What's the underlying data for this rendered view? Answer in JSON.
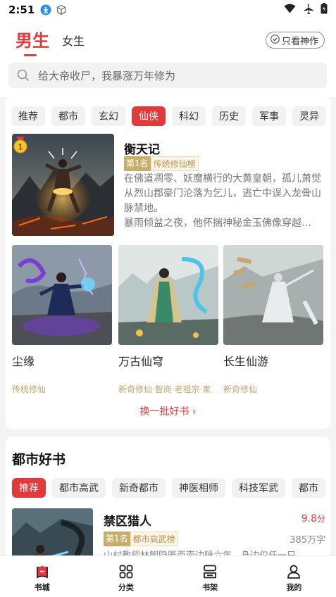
{
  "status_bar": {
    "time": "2:51"
  },
  "header": {
    "gender_active": "男生",
    "gender_other": "女生",
    "only_masterpiece": "只看神作",
    "search_placeholder": "给大帝收尸，我暴涨万年修为"
  },
  "category_tabs": [
    "推荐",
    "都市",
    "玄幻",
    "仙侠",
    "科幻",
    "历史",
    "军事",
    "灵异"
  ],
  "category_active": "仙侠",
  "featured_book": {
    "rank_badge": "1",
    "title": "衡天记",
    "rank_label": "第1名",
    "genre_label": "传统修仙榜",
    "description": "在佛道凋零、妖魔横行的大黄皇朝，孤儿萧觉从烈山郡豪门沦落为乞儿，逃亡中误入龙骨山脉禁地。",
    "description2": "暴雨倾盆之夜，他怀揣神秘金玉佛像穿越…"
  },
  "grid_books": [
    {
      "title": "尘缘",
      "tags": "传统修仙"
    },
    {
      "title": "万古仙穹",
      "tags": "新奇修仙·智商·老祖宗·家"
    },
    {
      "title": "长生仙游",
      "tags": "新奇修仙"
    }
  ],
  "refresh_label": "换一批好书",
  "section2": {
    "title": "都市好书",
    "tabs": [
      "推荐",
      "都市高武",
      "新奇都市",
      "神医相师",
      "科技军武",
      "都市"
    ],
    "active": "推荐",
    "book": {
      "title": "禁区猎人",
      "score": "9.8",
      "score_unit": "分",
      "rank_label": "第1名",
      "genre_label": "都市高武榜",
      "words": "385万字",
      "description": "山村教师林朝隐匿西南边陲六年，身边仅任一只…"
    }
  },
  "bottom_nav": [
    {
      "label": "书城",
      "icon": "bookstore-icon"
    },
    {
      "label": "分类",
      "icon": "category-grid-icon"
    },
    {
      "label": "书架",
      "icon": "bookshelf-icon"
    },
    {
      "label": "我的",
      "icon": "profile-icon"
    }
  ],
  "colors": {
    "accent": "#e23a3a",
    "gold": "#c8ad6b"
  }
}
